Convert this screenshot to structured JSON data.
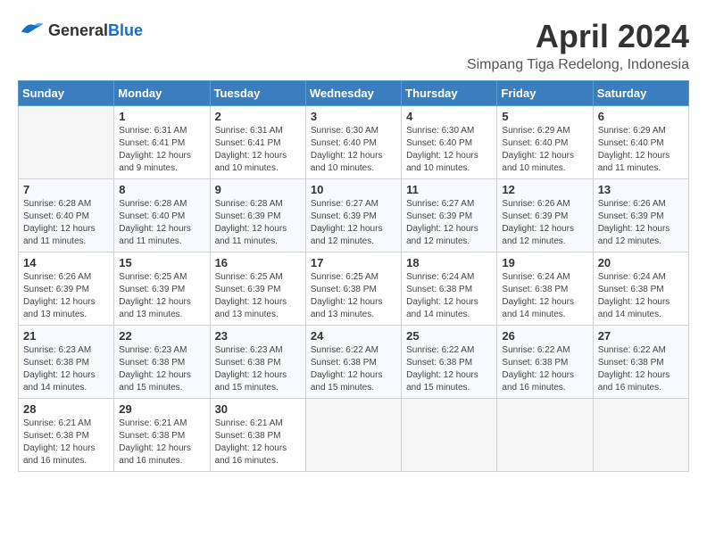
{
  "header": {
    "logo_general": "General",
    "logo_blue": "Blue",
    "title": "April 2024",
    "subtitle": "Simpang Tiga Redelong, Indonesia"
  },
  "weekdays": [
    "Sunday",
    "Monday",
    "Tuesday",
    "Wednesday",
    "Thursday",
    "Friday",
    "Saturday"
  ],
  "weeks": [
    [
      {
        "day": "",
        "sunrise": "",
        "sunset": "",
        "daylight": ""
      },
      {
        "day": "1",
        "sunrise": "Sunrise: 6:31 AM",
        "sunset": "Sunset: 6:41 PM",
        "daylight": "Daylight: 12 hours and 9 minutes."
      },
      {
        "day": "2",
        "sunrise": "Sunrise: 6:31 AM",
        "sunset": "Sunset: 6:41 PM",
        "daylight": "Daylight: 12 hours and 10 minutes."
      },
      {
        "day": "3",
        "sunrise": "Sunrise: 6:30 AM",
        "sunset": "Sunset: 6:40 PM",
        "daylight": "Daylight: 12 hours and 10 minutes."
      },
      {
        "day": "4",
        "sunrise": "Sunrise: 6:30 AM",
        "sunset": "Sunset: 6:40 PM",
        "daylight": "Daylight: 12 hours and 10 minutes."
      },
      {
        "day": "5",
        "sunrise": "Sunrise: 6:29 AM",
        "sunset": "Sunset: 6:40 PM",
        "daylight": "Daylight: 12 hours and 10 minutes."
      },
      {
        "day": "6",
        "sunrise": "Sunrise: 6:29 AM",
        "sunset": "Sunset: 6:40 PM",
        "daylight": "Daylight: 12 hours and 11 minutes."
      }
    ],
    [
      {
        "day": "7",
        "sunrise": "Sunrise: 6:28 AM",
        "sunset": "Sunset: 6:40 PM",
        "daylight": "Daylight: 12 hours and 11 minutes."
      },
      {
        "day": "8",
        "sunrise": "Sunrise: 6:28 AM",
        "sunset": "Sunset: 6:40 PM",
        "daylight": "Daylight: 12 hours and 11 minutes."
      },
      {
        "day": "9",
        "sunrise": "Sunrise: 6:28 AM",
        "sunset": "Sunset: 6:39 PM",
        "daylight": "Daylight: 12 hours and 11 minutes."
      },
      {
        "day": "10",
        "sunrise": "Sunrise: 6:27 AM",
        "sunset": "Sunset: 6:39 PM",
        "daylight": "Daylight: 12 hours and 12 minutes."
      },
      {
        "day": "11",
        "sunrise": "Sunrise: 6:27 AM",
        "sunset": "Sunset: 6:39 PM",
        "daylight": "Daylight: 12 hours and 12 minutes."
      },
      {
        "day": "12",
        "sunrise": "Sunrise: 6:26 AM",
        "sunset": "Sunset: 6:39 PM",
        "daylight": "Daylight: 12 hours and 12 minutes."
      },
      {
        "day": "13",
        "sunrise": "Sunrise: 6:26 AM",
        "sunset": "Sunset: 6:39 PM",
        "daylight": "Daylight: 12 hours and 12 minutes."
      }
    ],
    [
      {
        "day": "14",
        "sunrise": "Sunrise: 6:26 AM",
        "sunset": "Sunset: 6:39 PM",
        "daylight": "Daylight: 12 hours and 13 minutes."
      },
      {
        "day": "15",
        "sunrise": "Sunrise: 6:25 AM",
        "sunset": "Sunset: 6:39 PM",
        "daylight": "Daylight: 12 hours and 13 minutes."
      },
      {
        "day": "16",
        "sunrise": "Sunrise: 6:25 AM",
        "sunset": "Sunset: 6:39 PM",
        "daylight": "Daylight: 12 hours and 13 minutes."
      },
      {
        "day": "17",
        "sunrise": "Sunrise: 6:25 AM",
        "sunset": "Sunset: 6:38 PM",
        "daylight": "Daylight: 12 hours and 13 minutes."
      },
      {
        "day": "18",
        "sunrise": "Sunrise: 6:24 AM",
        "sunset": "Sunset: 6:38 PM",
        "daylight": "Daylight: 12 hours and 14 minutes."
      },
      {
        "day": "19",
        "sunrise": "Sunrise: 6:24 AM",
        "sunset": "Sunset: 6:38 PM",
        "daylight": "Daylight: 12 hours and 14 minutes."
      },
      {
        "day": "20",
        "sunrise": "Sunrise: 6:24 AM",
        "sunset": "Sunset: 6:38 PM",
        "daylight": "Daylight: 12 hours and 14 minutes."
      }
    ],
    [
      {
        "day": "21",
        "sunrise": "Sunrise: 6:23 AM",
        "sunset": "Sunset: 6:38 PM",
        "daylight": "Daylight: 12 hours and 14 minutes."
      },
      {
        "day": "22",
        "sunrise": "Sunrise: 6:23 AM",
        "sunset": "Sunset: 6:38 PM",
        "daylight": "Daylight: 12 hours and 15 minutes."
      },
      {
        "day": "23",
        "sunrise": "Sunrise: 6:23 AM",
        "sunset": "Sunset: 6:38 PM",
        "daylight": "Daylight: 12 hours and 15 minutes."
      },
      {
        "day": "24",
        "sunrise": "Sunrise: 6:22 AM",
        "sunset": "Sunset: 6:38 PM",
        "daylight": "Daylight: 12 hours and 15 minutes."
      },
      {
        "day": "25",
        "sunrise": "Sunrise: 6:22 AM",
        "sunset": "Sunset: 6:38 PM",
        "daylight": "Daylight: 12 hours and 15 minutes."
      },
      {
        "day": "26",
        "sunrise": "Sunrise: 6:22 AM",
        "sunset": "Sunset: 6:38 PM",
        "daylight": "Daylight: 12 hours and 16 minutes."
      },
      {
        "day": "27",
        "sunrise": "Sunrise: 6:22 AM",
        "sunset": "Sunset: 6:38 PM",
        "daylight": "Daylight: 12 hours and 16 minutes."
      }
    ],
    [
      {
        "day": "28",
        "sunrise": "Sunrise: 6:21 AM",
        "sunset": "Sunset: 6:38 PM",
        "daylight": "Daylight: 12 hours and 16 minutes."
      },
      {
        "day": "29",
        "sunrise": "Sunrise: 6:21 AM",
        "sunset": "Sunset: 6:38 PM",
        "daylight": "Daylight: 12 hours and 16 minutes."
      },
      {
        "day": "30",
        "sunrise": "Sunrise: 6:21 AM",
        "sunset": "Sunset: 6:38 PM",
        "daylight": "Daylight: 12 hours and 16 minutes."
      },
      {
        "day": "",
        "sunrise": "",
        "sunset": "",
        "daylight": ""
      },
      {
        "day": "",
        "sunrise": "",
        "sunset": "",
        "daylight": ""
      },
      {
        "day": "",
        "sunrise": "",
        "sunset": "",
        "daylight": ""
      },
      {
        "day": "",
        "sunrise": "",
        "sunset": "",
        "daylight": ""
      }
    ]
  ]
}
